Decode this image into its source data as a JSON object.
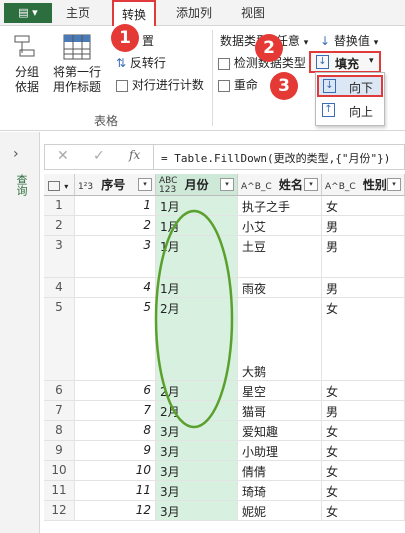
{
  "tabs": {
    "file_label": "▤ ▾",
    "home": "主页",
    "transform": "转换",
    "add_column": "添加列",
    "view": "视图"
  },
  "ribbon": {
    "group_by": "分组\n依据",
    "first_row_headers": "将第一行\n用作标题",
    "transpose": "置",
    "reverse_rows": "反转行",
    "count_rows": "对行进行计数",
    "table_group": "表格",
    "data_type": "数据类型: 任意",
    "detect_type": "检测数据类型",
    "rename": "重命",
    "replace_values": "替换值",
    "fill": "填充",
    "fill_down": "向下",
    "fill_up": "向上"
  },
  "steps": [
    "1",
    "2",
    "3"
  ],
  "formula": "= Table.FillDown(更改的类型,{\"月份\"})",
  "fx": "fx",
  "left_pane_label": "查询",
  "columns": [
    {
      "type_icon": "1²3",
      "name": "序号"
    },
    {
      "type_icon": "ABC\n123",
      "name": "月份"
    },
    {
      "type_icon": "A^B_C",
      "name": "姓名"
    },
    {
      "type_icon": "A^B_C",
      "name": "性别"
    }
  ],
  "rows": [
    {
      "idx": "1",
      "seq": "1",
      "month": "1月",
      "name": "执子之手",
      "gender": "女"
    },
    {
      "idx": "2",
      "seq": "2",
      "month": "1月",
      "name": "小艾",
      "gender": "男"
    },
    {
      "idx": "3",
      "seq": "3",
      "month": "1月",
      "name": "土豆",
      "gender": "男"
    },
    {
      "idx": "4",
      "seq": "4",
      "month": "1月",
      "name": "雨夜",
      "gender": "男"
    },
    {
      "idx": "5",
      "seq": "5",
      "month": "2月",
      "name": "大鹅",
      "gender": "女"
    },
    {
      "idx": "6",
      "seq": "6",
      "month": "2月",
      "name": "星空",
      "gender": "女"
    },
    {
      "idx": "7",
      "seq": "7",
      "month": "2月",
      "name": "猫哥",
      "gender": "男"
    },
    {
      "idx": "8",
      "seq": "8",
      "month": "3月",
      "name": "爱知趣",
      "gender": "女"
    },
    {
      "idx": "9",
      "seq": "9",
      "month": "3月",
      "name": "小助理",
      "gender": "女"
    },
    {
      "idx": "10",
      "seq": "10",
      "month": "3月",
      "name": "倩倩",
      "gender": "女"
    },
    {
      "idx": "11",
      "seq": "11",
      "month": "3月",
      "name": "琦琦",
      "gender": "女"
    },
    {
      "idx": "12",
      "seq": "12",
      "month": "3月",
      "name": "妮妮",
      "gender": "女"
    }
  ],
  "colors": {
    "accent_red": "#e03a3a",
    "highlight_green": "#d8f0e0",
    "ellipse_green": "#5aa02c"
  }
}
